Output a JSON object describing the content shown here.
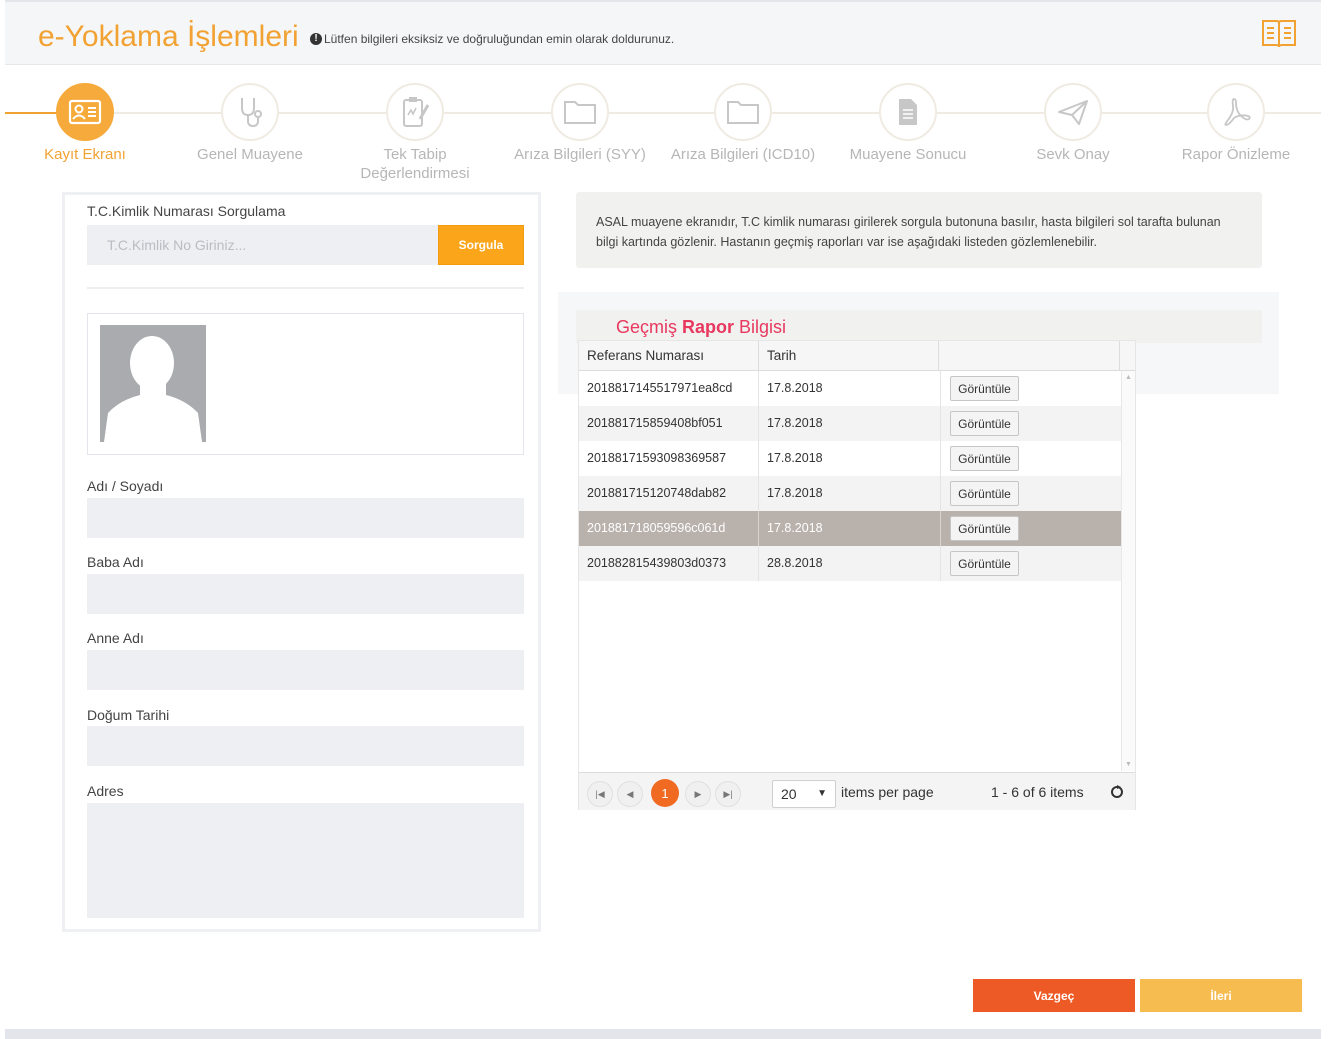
{
  "header": {
    "title": "e-Yoklama İşlemleri",
    "info_text": "Lütfen bilgileri eksiksiz ve doğruluğundan emin olarak doldurunuz.",
    "accent_color": "#f2a233"
  },
  "steps": [
    {
      "label": "Kayıt Ekranı",
      "icon": "id-card-icon",
      "active": true
    },
    {
      "label": "Genel Muayene",
      "icon": "stethoscope-icon",
      "active": false
    },
    {
      "label": "Tek Tabip Değerlendirmesi",
      "icon": "clipboard-pen-icon",
      "active": false
    },
    {
      "label": "Arıza Bilgileri (SYY)",
      "icon": "folder-icon",
      "active": false
    },
    {
      "label": "Arıza Bilgileri (ICD10)",
      "icon": "folder-icon",
      "active": false
    },
    {
      "label": "Muayene Sonucu",
      "icon": "document-icon",
      "active": false
    },
    {
      "label": "Sevk Onay",
      "icon": "paper-plane-icon",
      "active": false
    },
    {
      "label": "Rapor Önizleme",
      "icon": "pdf-icon",
      "active": false
    }
  ],
  "left": {
    "tc_label": "T.C.Kimlik Numarası Sorgulama",
    "tc_placeholder": "T.C.Kimlik No Giriniz...",
    "tc_value": "",
    "query_button": "Sorgula",
    "fields": {
      "name_label": "Adı / Soyadı",
      "father_label": "Baba Adı",
      "mother_label": "Anne Adı",
      "birth_label": "Doğum Tarihi",
      "address_label": "Adres"
    }
  },
  "info_box": {
    "text": "ASAL muayene ekranıdır, T.C kimlik numarası girilerek sorgula butonuna basılır, hasta bilgileri sol tarafta bulunan bilgi kartında gözlenir. Hastanın geçmiş raporları var ise aşağıdaki listeden gözlemlenebilir."
  },
  "history": {
    "title_pre": "Geçmiş ",
    "title_bold": "Rapor",
    "title_post": " Bilgisi",
    "columns": [
      "Referans Numarası",
      "Tarih",
      ""
    ],
    "view_label": "Görüntüle",
    "rows": [
      {
        "ref": "2018817145517971ea8cd",
        "date": "17.8.2018",
        "selected": false
      },
      {
        "ref": "201881715859408bf051",
        "date": "17.8.2018",
        "selected": false
      },
      {
        "ref": "20188171593098369587",
        "date": "17.8.2018",
        "selected": false
      },
      {
        "ref": "201881715120748dab82",
        "date": "17.8.2018",
        "selected": false
      },
      {
        "ref": "201881718059596c061d",
        "date": "17.8.2018",
        "selected": true
      },
      {
        "ref": "201882815439803d0373",
        "date": "28.8.2018",
        "selected": false
      }
    ],
    "pager": {
      "current_page": "1",
      "page_size": "20",
      "items_per_page": "items per page",
      "summary": "1 - 6 of 6 items"
    }
  },
  "buttons": {
    "cancel": "Vazgeç",
    "next": "İleri"
  }
}
